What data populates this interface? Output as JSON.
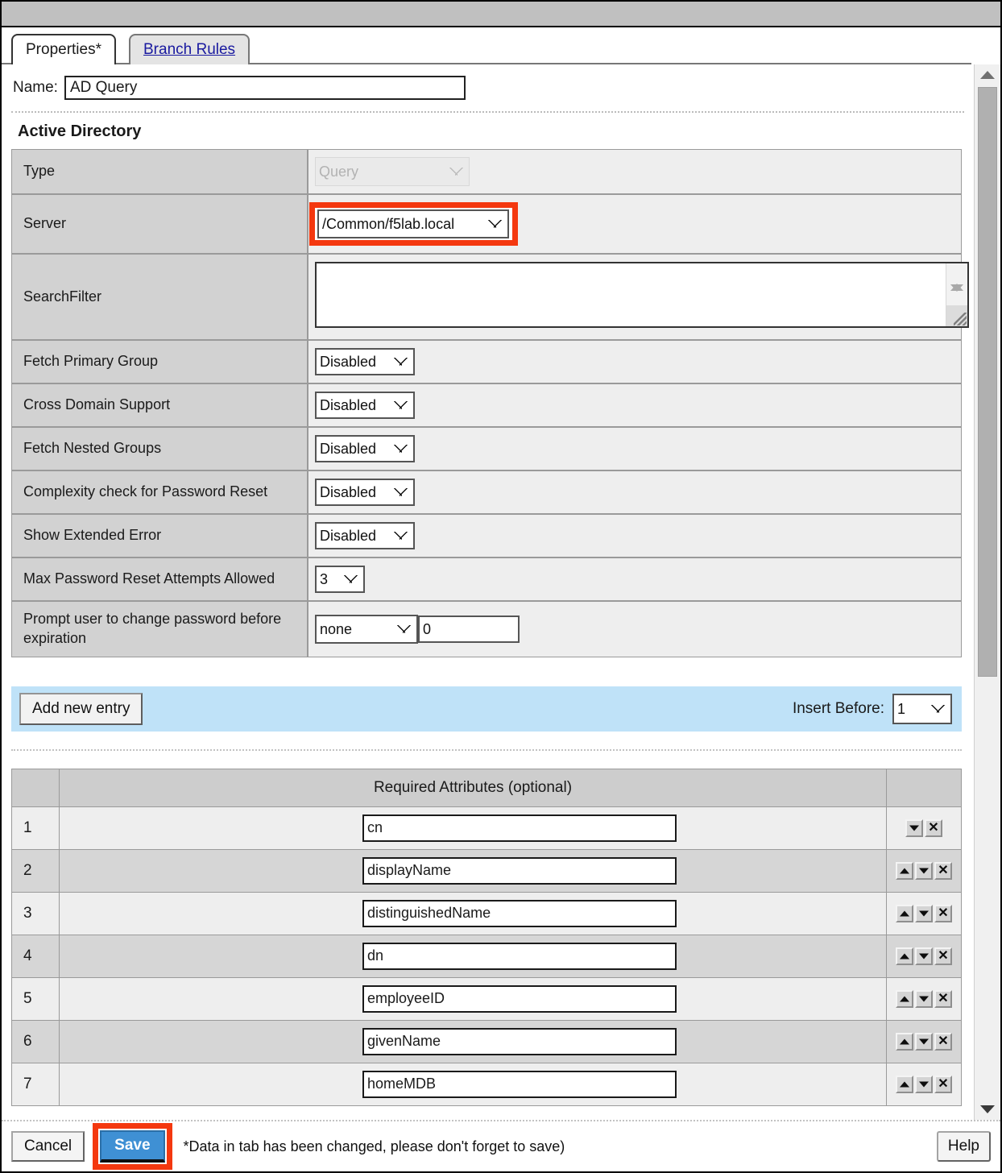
{
  "window": {
    "titlebar_label": ""
  },
  "tabs": [
    {
      "label": "Properties*",
      "active": true
    },
    {
      "label": "Branch Rules",
      "active": false
    }
  ],
  "name_field": {
    "label": "Name:",
    "value": "AD Query",
    "placeholder": ""
  },
  "section": {
    "title": "Active Directory"
  },
  "properties": [
    {
      "label": "Type",
      "control": "select",
      "value": "Query",
      "disabled": true
    },
    {
      "label": "Server",
      "control": "select",
      "value": "/Common/f5lab.local",
      "highlighted": true
    },
    {
      "label": "SearchFilter",
      "control": "textarea",
      "value": ""
    },
    {
      "label": "Fetch Primary Group",
      "control": "select",
      "value": "Disabled"
    },
    {
      "label": "Cross Domain Support",
      "control": "select",
      "value": "Disabled"
    },
    {
      "label": "Fetch Nested Groups",
      "control": "select",
      "value": "Disabled"
    },
    {
      "label": "Complexity check for Password Reset",
      "control": "select",
      "value": "Disabled"
    },
    {
      "label": "Show Extended Error",
      "control": "select",
      "value": "Disabled"
    },
    {
      "label": "Max Password Reset Attempts Allowed",
      "control": "select",
      "value": "3"
    },
    {
      "label": "Prompt user to change password before expiration",
      "control": "select+input",
      "value": "none",
      "value2": "0"
    }
  ],
  "entry_bar": {
    "add_button": "Add new entry",
    "insert_before_label": "Insert Before:",
    "insert_before_value": "1"
  },
  "attributes_table": {
    "header_index": "",
    "header_main": "Required Attributes (optional)",
    "header_actions": "",
    "rows": [
      {
        "index": "1",
        "value": "cn",
        "has_up": false,
        "has_down": true,
        "has_delete": true
      },
      {
        "index": "2",
        "value": "displayName",
        "has_up": true,
        "has_down": true,
        "has_delete": true
      },
      {
        "index": "3",
        "value": "distinguishedName",
        "has_up": true,
        "has_down": true,
        "has_delete": true
      },
      {
        "index": "4",
        "value": "dn",
        "has_up": true,
        "has_down": true,
        "has_delete": true
      },
      {
        "index": "5",
        "value": "employeeID",
        "has_up": true,
        "has_down": true,
        "has_delete": true
      },
      {
        "index": "6",
        "value": "givenName",
        "has_up": true,
        "has_down": true,
        "has_delete": true
      },
      {
        "index": "7",
        "value": "homeMDB",
        "has_up": true,
        "has_down": true,
        "has_delete": true
      }
    ]
  },
  "footer": {
    "cancel_label": "Cancel",
    "save_label": "Save",
    "message": "*Data in tab has been changed, please don't forget to save)",
    "help_label": "Help"
  },
  "icons": {
    "move_up": "move-up-icon",
    "move_down": "move-down-icon",
    "delete": "delete-x-icon",
    "scroll_up": "scroll-up-arrow-icon",
    "scroll_down": "scroll-down-arrow-icon",
    "resize_grip": "resize-grip-icon"
  },
  "colors": {
    "highlight_red": "#f4380f",
    "save_blue": "#3f90d4",
    "entry_bar_blue": "#bfe2f8",
    "label_gray": "#d2d2d2",
    "value_gray": "#eeeeee"
  }
}
